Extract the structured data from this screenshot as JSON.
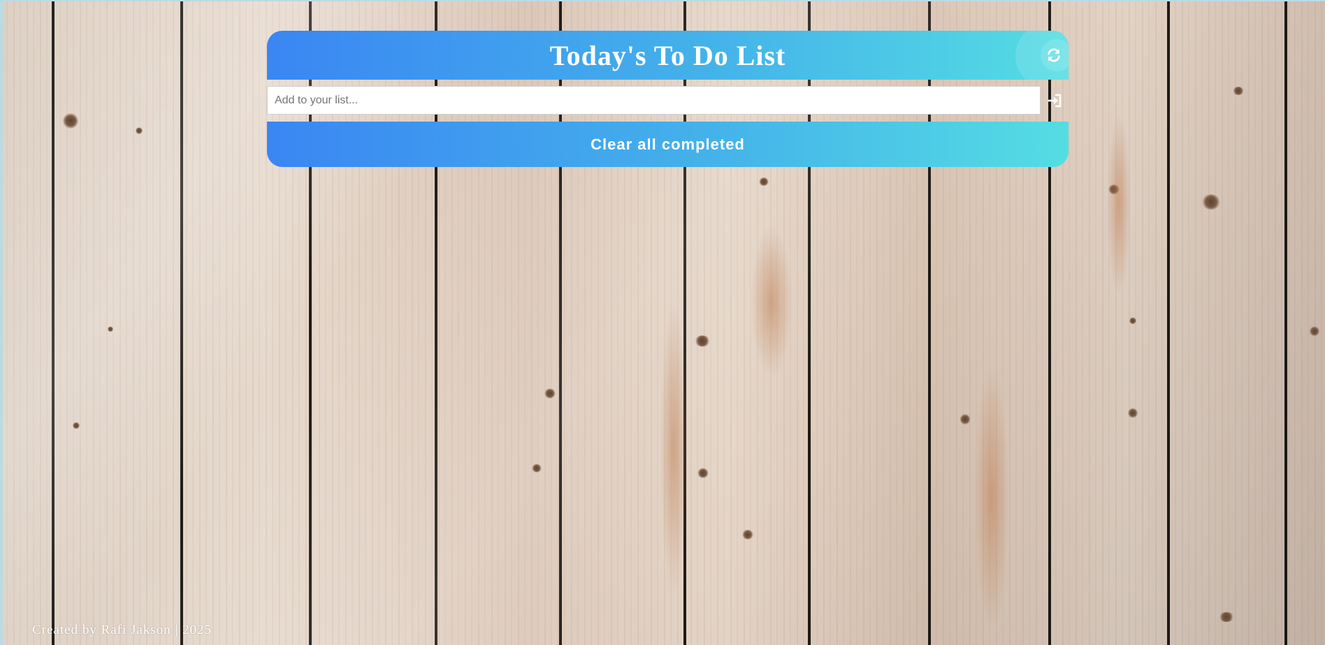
{
  "header": {
    "title": "Today's To Do List",
    "refresh_icon": "refresh-icon"
  },
  "input": {
    "placeholder": "Add to your list...",
    "value": "",
    "add_icon": "sign-in-icon"
  },
  "actions": {
    "clear_label": "Clear all completed"
  },
  "footer": {
    "credit": "Created by Rafi Jakson | 2025"
  },
  "colors": {
    "gradient_start": "#3a86f3",
    "gradient_mid": "#44b2ea",
    "gradient_end": "#54dde3",
    "text": "#ffffff"
  }
}
